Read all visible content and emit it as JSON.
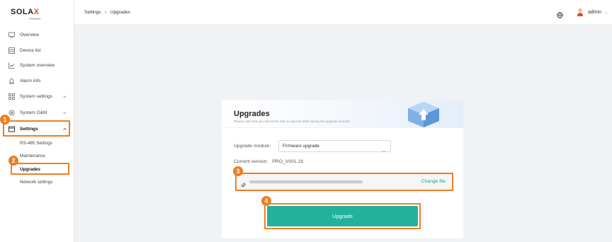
{
  "brand": {
    "word_a": "SOLA",
    "word_x": "X",
    "sub": "POWER",
    "accent": "#e8452c"
  },
  "sidebar": {
    "items": [
      {
        "label": "Overview",
        "icon": "monitor-icon"
      },
      {
        "label": "Device list",
        "icon": "list-icon"
      },
      {
        "label": "System overview",
        "icon": "chart-icon"
      },
      {
        "label": "Alarm info",
        "icon": "alarm-icon"
      },
      {
        "label": "System settings",
        "icon": "grid-icon"
      },
      {
        "label": "System O&M",
        "icon": "wrench-icon"
      },
      {
        "label": "Settings",
        "icon": "settings-icon"
      }
    ],
    "sub_items": [
      "RS-485 Settings",
      "Maintenance",
      "Upgrades",
      "Network settings"
    ]
  },
  "topbar": {
    "breadcrumb_parent": "Settings",
    "breadcrumb_sep": "»",
    "breadcrumb_current": "Upgrades",
    "user": "admin"
  },
  "card": {
    "title": "Upgrades",
    "note": "Please note that you will not be able to operate EMS during the upgrade process",
    "module_label": "Upgrade module:",
    "module_value": "Firmware upgrade",
    "version_label": "Current version:",
    "version_value": "PRO_V001.18",
    "change_file": "Change file",
    "upgrade_button": "Upgrade"
  },
  "steps": [
    "1",
    "2",
    "3",
    "4"
  ],
  "colors": {
    "highlight": "#ef7d22",
    "primary": "#23b19c",
    "link": "#1a9e8f"
  }
}
